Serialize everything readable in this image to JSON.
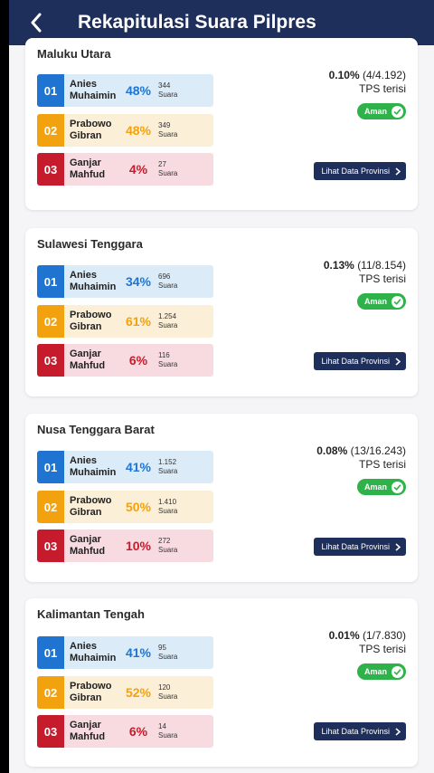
{
  "header": {
    "title": "Rekapitulasi Suara Pilpres"
  },
  "candidates": [
    {
      "num": "01",
      "first": "Anies",
      "second": "Muhaimin"
    },
    {
      "num": "02",
      "first": "Prabowo",
      "second": "Gibran"
    },
    {
      "num": "03",
      "first": "Ganjar",
      "second": "Mahfud"
    }
  ],
  "labels": {
    "suara": "Suara",
    "tps_terisi": "TPS terisi",
    "aman": "Aman",
    "lihat": "Lihat Data Provinsi"
  },
  "colors": {
    "appbar": "#1f2f5c",
    "c01": "#1f74d1",
    "c02": "#f2a20f",
    "c03": "#c61b2d",
    "aman": "#2fb24a"
  },
  "provinces": [
    {
      "name": "Maluku Utara",
      "tps_pct": "0.10%",
      "tps_count": "(4/4.192)",
      "results": [
        {
          "pct": "48%",
          "votes": "344"
        },
        {
          "pct": "48%",
          "votes": "349"
        },
        {
          "pct": "4%",
          "votes": "27"
        }
      ]
    },
    {
      "name": "Sulawesi Tenggara",
      "tps_pct": "0.13%",
      "tps_count": "(11/8.154)",
      "results": [
        {
          "pct": "34%",
          "votes": "696"
        },
        {
          "pct": "61%",
          "votes": "1.254"
        },
        {
          "pct": "6%",
          "votes": "116"
        }
      ]
    },
    {
      "name": "Nusa Tenggara Barat",
      "tps_pct": "0.08%",
      "tps_count": "(13/16.243)",
      "results": [
        {
          "pct": "41%",
          "votes": "1.152"
        },
        {
          "pct": "50%",
          "votes": "1.410"
        },
        {
          "pct": "10%",
          "votes": "272"
        }
      ]
    },
    {
      "name": "Kalimantan Tengah",
      "tps_pct": "0.01%",
      "tps_count": "(1/7.830)",
      "results": [
        {
          "pct": "41%",
          "votes": "95"
        },
        {
          "pct": "52%",
          "votes": "120"
        },
        {
          "pct": "6%",
          "votes": "14"
        }
      ]
    }
  ]
}
